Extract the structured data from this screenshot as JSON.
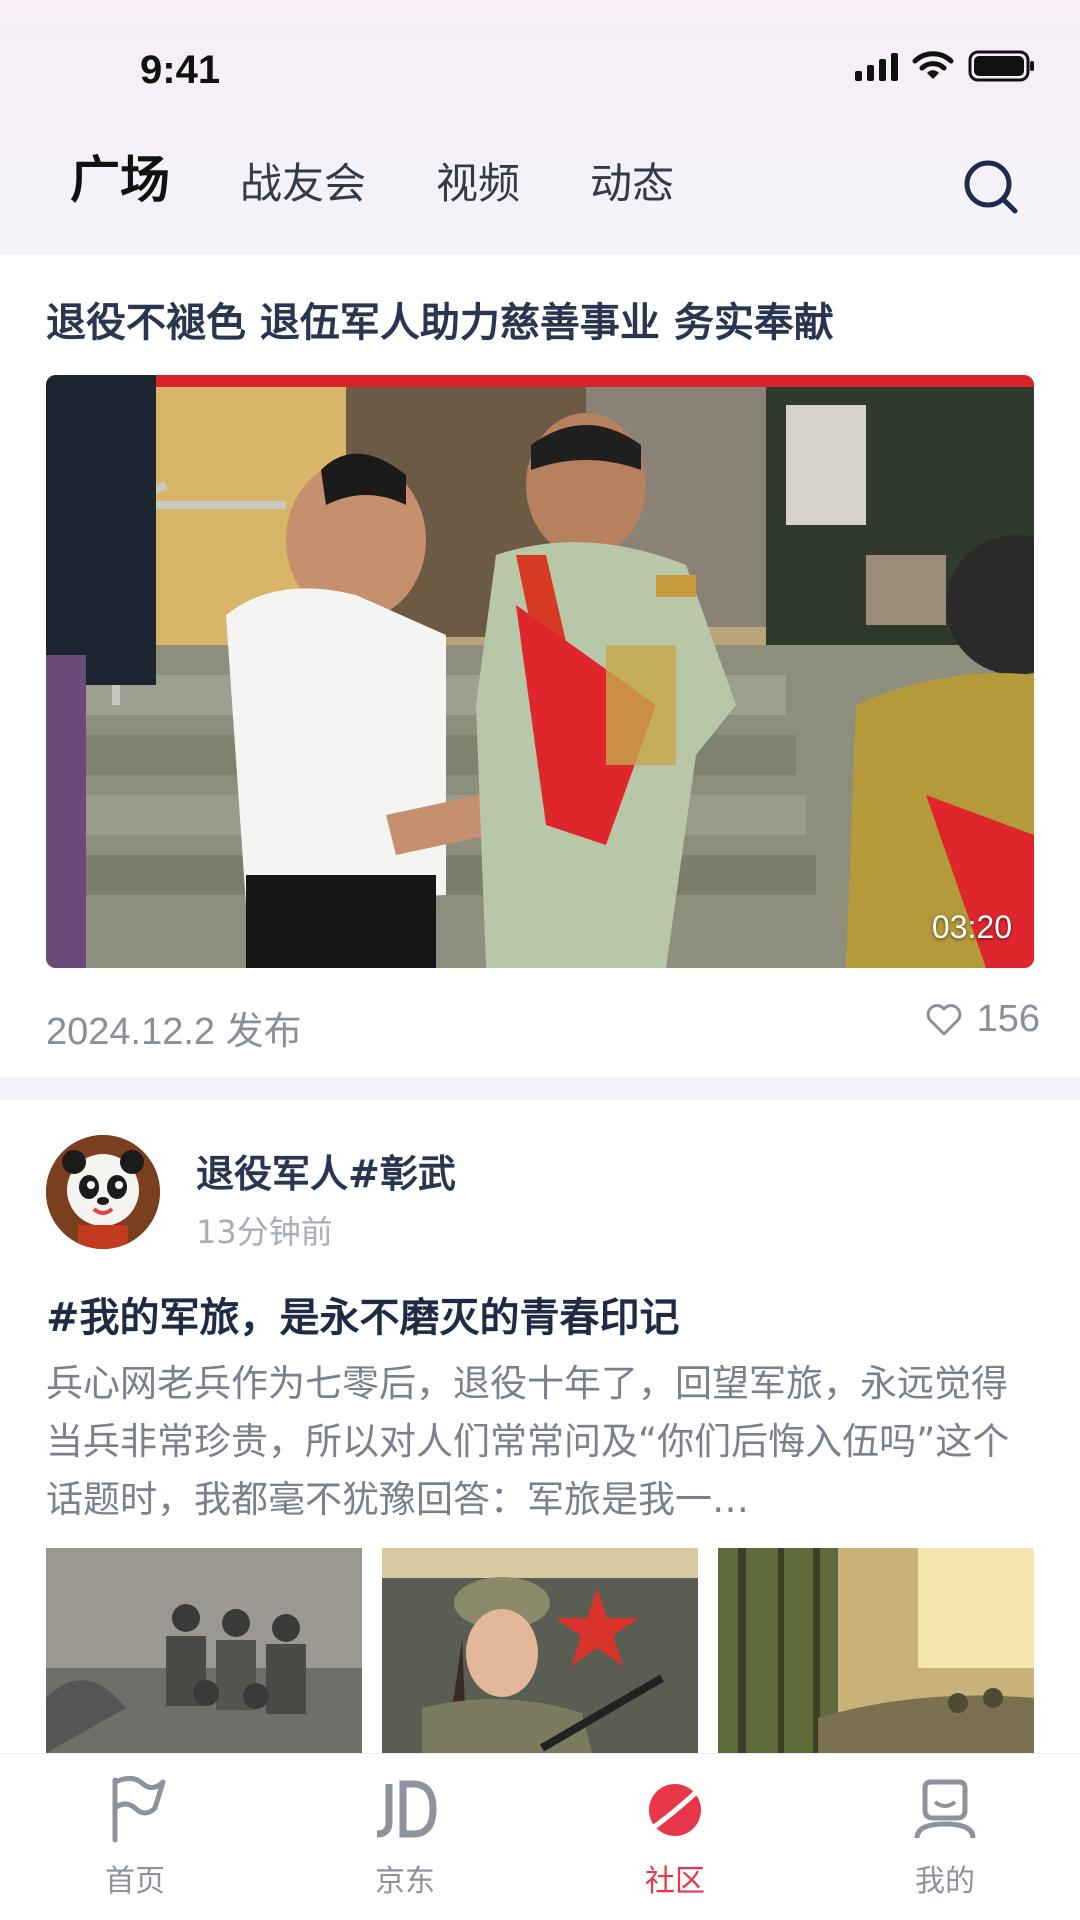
{
  "status_bar": {
    "time": "9:41"
  },
  "header": {
    "tabs": [
      {
        "label": "广场",
        "active": true
      },
      {
        "label": "战友会",
        "active": false
      },
      {
        "label": "视频",
        "active": false
      },
      {
        "label": "动态",
        "active": false
      }
    ],
    "search_icon": "search-icon"
  },
  "feed": {
    "video_post": {
      "title": "退役不褪色 退伍军人助力慈善事业 务实奉献",
      "duration": "03:20",
      "published": "2024.12.2 发布",
      "likes": "156"
    },
    "user_post": {
      "author": "退役军人#彰武",
      "time": "13分钟前",
      "title": "#我的军旅，是永不磨灭的青春印记",
      "body": "兵心网老兵作为七零后，退役十年了，回望军旅，永远觉得当兵非常珍贵，所以对人们常常问及“你们后悔入伍吗”这个话题时，我都毫不犹豫回答：军旅是我一…",
      "images": [
        "old-soldiers-photo",
        "female-soldier-photo",
        "forest-soldiers-photo"
      ]
    }
  },
  "bottom_nav": {
    "items": [
      {
        "label": "首页",
        "icon": "flag-icon",
        "active": false
      },
      {
        "label": "京东",
        "icon": "jd-icon",
        "active": false
      },
      {
        "label": "社区",
        "icon": "planet-icon",
        "active": true
      },
      {
        "label": "我的",
        "icon": "profile-icon",
        "active": false
      }
    ]
  },
  "colors": {
    "accent": "#e8364a",
    "title": "#1f2a44",
    "muted": "#8a8f99"
  }
}
